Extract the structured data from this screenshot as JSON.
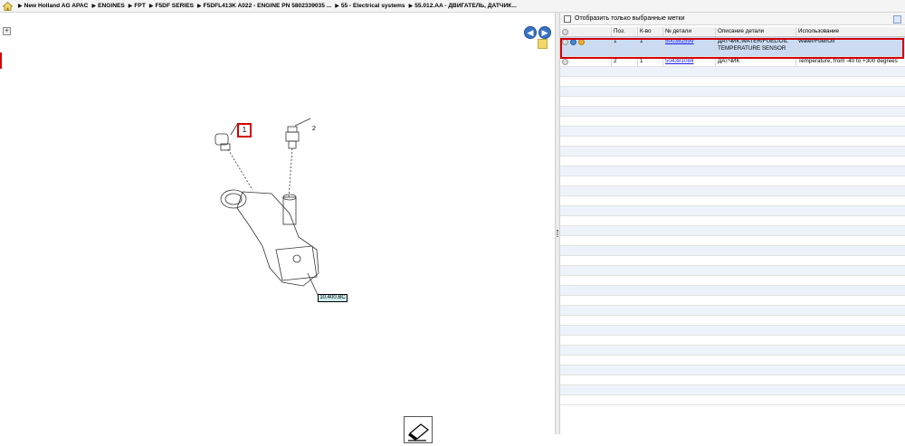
{
  "breadcrumb": {
    "items": [
      "New Holland AG APAC",
      "ENGINES",
      "FPT",
      "F5DF SERIES",
      "F5DFL413K A022 - ENGINE PN 5802339035 ...",
      "55 - Electrical systems",
      "55.012.AA - ДВИГАТЕЛЬ, ДАТЧИК..."
    ]
  },
  "diagram": {
    "callout_1": "1",
    "callout_2": "2",
    "ref_label": "10.400.BC"
  },
  "filter": {
    "label": "Отобразить только выбранные метки",
    "checked": false
  },
  "table": {
    "headers": {
      "pos": "Поз.",
      "qty": "К-во",
      "part": "№ детали",
      "desc": "Описание детали",
      "use": "Использование"
    },
    "rows": [
      {
        "pos": "1",
        "qty": "1",
        "part": "500382599",
        "desc": "ДАТЧИК,WATER/FUEL/OIL TEMPERATURE SENSOR",
        "use": "Water/Fuel/Oil"
      },
      {
        "pos": "2",
        "qty": "1",
        "part": "504381084",
        "desc": "ДАТЧИК",
        "use": "Temperature, from -40 to +300 degrees"
      }
    ]
  },
  "colors": {
    "highlight": "#d60000",
    "selected_row": "#cbdcf2",
    "nav_blue": "#3a74c4"
  }
}
